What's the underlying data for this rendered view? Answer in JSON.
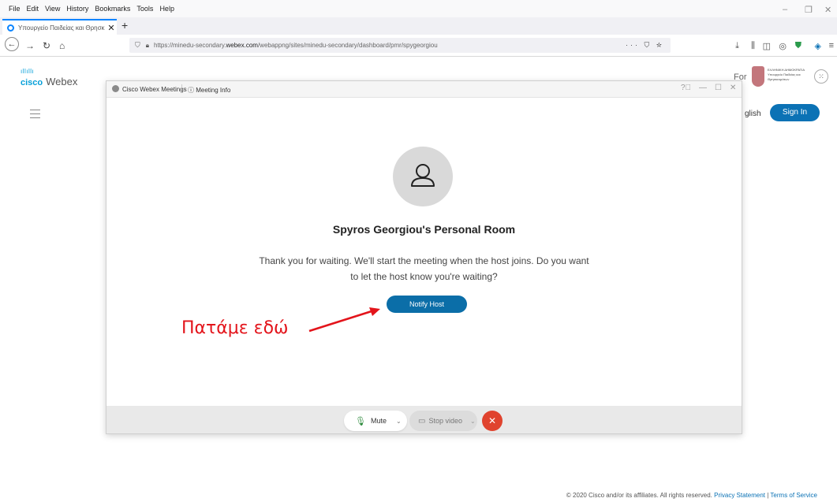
{
  "browser": {
    "menu": [
      "File",
      "Edit",
      "View",
      "History",
      "Bookmarks",
      "Tools",
      "Help"
    ],
    "tab_title": "Υπουργείο Παιδείας και Θρησκ",
    "url_prefix": "https://minedu-secondary.",
    "url_domain": "webex.com",
    "url_suffix": "/webappng/sites/minedu-secondary/dashboard/pmr/spygeorgiou"
  },
  "page": {
    "brand_cisco": "cisco",
    "brand_webex": "Webex",
    "for_label": "For",
    "ministry_text": "ΕΛΛΗΝΙΚΗ ΔΗΜΟΚΡΑΤΙΑ Υπουργείο Παιδείας και Θρησκευμάτων",
    "language": "glish",
    "sign_in": "Sign In",
    "footer_copyright": "© 2020 Cisco and/or its affiliates. All rights reserved.",
    "footer_privacy": "Privacy Statement",
    "footer_sep": "|",
    "footer_terms": "Terms of Service"
  },
  "meeting": {
    "app_name": "Cisco Webex Meetings",
    "info_label": "Meeting Info",
    "room_name": "Spyros Georgiou's Personal Room",
    "wait_message": "Thank you for waiting. We'll start the meeting when the host joins. Do you want to let the host know you're waiting?",
    "notify_button": "Notify Host",
    "mute_label": "Mute",
    "video_label": "Stop video"
  },
  "annotation": {
    "text": "Πατάμε εδώ",
    "color": "#e3141b"
  },
  "colors": {
    "accent": "#0b72b5",
    "leave": "#e0432e"
  }
}
